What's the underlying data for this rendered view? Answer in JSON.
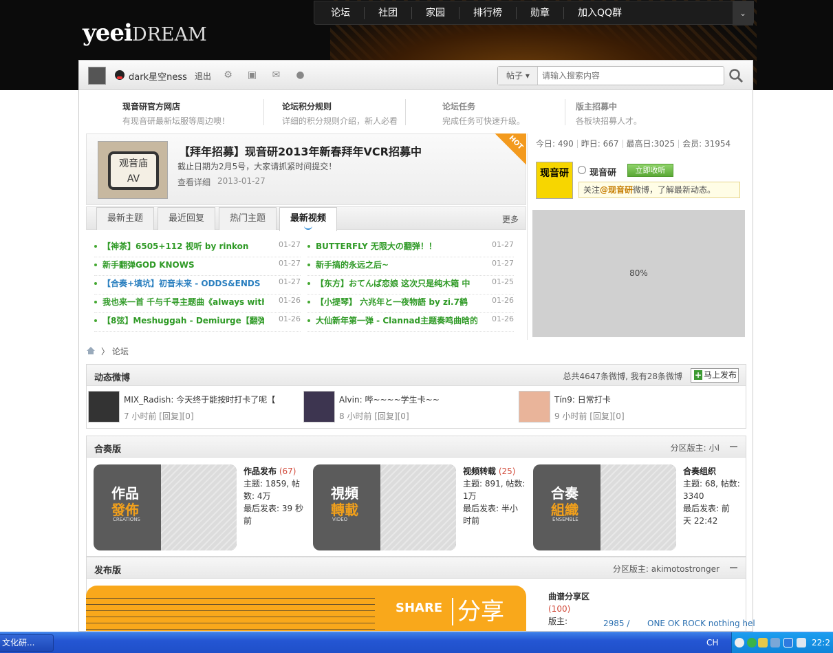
{
  "site": {
    "logo_main": "yeei",
    "logo_sub": "DREAM"
  },
  "topnav": {
    "items": [
      "论坛",
      "社团",
      "家园",
      "排行榜",
      "勋章",
      "加入QQ群"
    ],
    "dropdown": "⌄"
  },
  "userbar": {
    "username": "dark星空ness",
    "logout": "退出",
    "search_category": "帖子 ▾",
    "search_placeholder": "请输入搜索内容"
  },
  "links": [
    {
      "title": "现音研官方网店",
      "desc": "有现音研最新坛服等周边噢！"
    },
    {
      "title": "论坛积分规则",
      "desc": "详细的积分规则介绍，新人必看"
    },
    {
      "title": "论坛任务",
      "desc": "完成任务可快速升级。"
    },
    {
      "title": "版主招募中",
      "desc": "各板块招募人才。"
    }
  ],
  "feature": {
    "img_l1": "观音庙",
    "img_l2": "AV",
    "title": "【拜年招募】现音研2013年新春拜年VCR招募中",
    "desc": "截止日期为2月5号，大家请抓紧时间提交！",
    "more": "查看详细",
    "date": "2013-01-27",
    "hot": "HOT"
  },
  "stats": {
    "today": "今日: 490",
    "yesterday": "昨日: 667",
    "max": "最高日:3025",
    "members": "会员: 31954"
  },
  "weibo_box": {
    "img_text": "现音研",
    "name": "现音研",
    "follow": "立即收听",
    "tip_pre": "关注",
    "tip_name": "@现音研",
    "tip_post": "微博，了解最新动态。"
  },
  "ad": {
    "text": "80%"
  },
  "tabs": {
    "items": [
      "最新主题",
      "最近回复",
      "热门主题",
      "最新视频"
    ],
    "more": "更多"
  },
  "threads_left": [
    {
      "title": "【神茶】6505+112 视听 by rinkon",
      "date": "01-27"
    },
    {
      "title": "新手翻弹GOD KNOWS",
      "date": "01-27"
    },
    {
      "title": "【合奏+填坑】初音未来 - ODDS&ENDS",
      "date": "01-27"
    },
    {
      "title": "我也来一首 千与千寻主题曲《always with",
      "date": "01-26"
    },
    {
      "title": "【8弦】Meshuggah - Demiurge【翻弹】",
      "date": "01-26"
    }
  ],
  "threads_right": [
    {
      "title": "BUTTERFLY 无限大の翻弹！！",
      "date": "01-27"
    },
    {
      "title": "新手搞的永远之后~",
      "date": "01-27"
    },
    {
      "title": "【东方】おてんば恋娘 这次只是纯木箱 中",
      "date": "01-25"
    },
    {
      "title": "【小提琴】 六兆年と一夜物語 by zi.7鹤",
      "date": "01-26"
    },
    {
      "title": "大仙新年第一弹 - Clannad主题奏鸣曲晗的",
      "date": "01-26"
    }
  ],
  "breadcrumb": {
    "sep": "〉",
    "current": "论坛"
  },
  "dongtai": {
    "title": "动态微博",
    "count": "总共4647条微博, 我有28条微博",
    "post": "马上发布",
    "items": [
      {
        "text": "MIX_Radish: 今天终于能按时打卡了呢【",
        "meta": "7 小时前 [回复][0]"
      },
      {
        "text": "Alvin: 哔~~~~学生卡~~",
        "meta": "8 小时前 [回复][0]"
      },
      {
        "text": "Tín9: 日常打卡",
        "meta": "9 小时前 [回复][0]"
      }
    ]
  },
  "hezou": {
    "title": "合奏版",
    "mod": "分区版主: 小I",
    "forums": [
      {
        "w1": "作品",
        "w2": "發佈",
        "w3": "CREATIONS",
        "name": "作品发布",
        "count": "(67)",
        "l1": "主题: 1859, 帖",
        "l2": "数: 4万",
        "l3": "最后发表: 39 秒",
        "l4": "前"
      },
      {
        "w1": "視頻",
        "w2": "轉載",
        "w3": "VIDEO",
        "name": "视频转载",
        "count": "(25)",
        "l1": "主题: 891, 帖数:",
        "l2": "1万",
        "l3": "最后发表: 半小",
        "l4": "时前"
      },
      {
        "w1": "合奏",
        "w2": "組織",
        "w3": "ENSEMBLE",
        "name": "合奏组织",
        "count": "",
        "l1": "主题: 68, 帖数:",
        "l2": "3340",
        "l3": "最后发表: 前",
        "l4": "天 22:42"
      }
    ]
  },
  "fabu": {
    "title": "发布版",
    "mod": "分区版主: akimotostronger",
    "share": "SHARE",
    "fx": "分享",
    "forum_name": "曲谱分享区",
    "count": "(100)",
    "mod_label": "版主:",
    "num": "2985 /",
    "latest": "ONE OK ROCK nothing hel"
  },
  "taskbar": {
    "task": "文化研...",
    "lang": "CH",
    "clock": "22:2"
  }
}
